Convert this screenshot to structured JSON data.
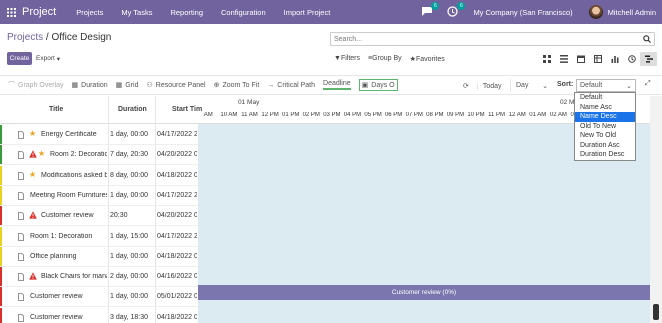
{
  "navbar": {
    "app": "Project",
    "menus": [
      "Projects",
      "My Tasks",
      "Reporting",
      "Configuration",
      "Import Project"
    ],
    "messages_count": "6",
    "activities_count": "6",
    "company": "My Company (San Francisco)",
    "user": "Mitchell Admin",
    "bg_color": "#71639e"
  },
  "breadcrumb": {
    "parent": "Projects",
    "separator": "/",
    "current": "Office Design"
  },
  "search": {
    "placeholder": "Search..."
  },
  "buttons": {
    "create": "Create",
    "export": "Export"
  },
  "filters": {
    "filters": "Filters",
    "group_by": "Group By",
    "favorites": "Favorites"
  },
  "toolbar": {
    "graph_overlay": "Graph Overlay",
    "duration": "Duration",
    "grid": "Grid",
    "resource_panel": "Resource Panel",
    "zoom_to_fit": "Zoom To Fit",
    "critical_path": "Critical Path",
    "deadline": "Deadline",
    "days_o": "Days O",
    "today": "Today",
    "scale": "Day",
    "sort_label": "Sort:",
    "sort_value": "Default"
  },
  "sort_options": [
    "Default",
    "Name Asc",
    "Name Desc",
    "Old To New",
    "New To Old",
    "Duration Asc",
    "Duration Desc"
  ],
  "sort_selected": "Name Desc",
  "columns": {
    "title": "Title",
    "duration": "Duration",
    "start": "Start Tim"
  },
  "timeline": {
    "date1": "01 May",
    "date2": "02 M",
    "hours": [
      "AM",
      "10 AM",
      "11 AM",
      "12 PM",
      "01 PM",
      "02 PM",
      "03 PM",
      "04 PM",
      "05 PM",
      "06 PM",
      "07 PM",
      "08 PM",
      "09 PM",
      "10 PM",
      "11 PM",
      "12 AM",
      "01 AM",
      "02 AM",
      "03 AM",
      "04 AM",
      "05 AM"
    ]
  },
  "rows": [
    {
      "title": "Energy Certificate",
      "duration": "1 day, 00:00",
      "start": "04/17/2022 2",
      "flag": "#3b9a3b",
      "warn": false,
      "star": true
    },
    {
      "title": "Room 2: Decoration",
      "duration": "7 day, 20:30",
      "start": "04/20/2022 0",
      "flag": "#3b9a3b",
      "warn": true,
      "star": true
    },
    {
      "title": "Modifications asked by",
      "duration": "8 day, 00:00",
      "start": "04/18/2022 0",
      "flag": "#e8d21d",
      "warn": false,
      "star": true
    },
    {
      "title": "Meeting Room Furnitures",
      "duration": "1 day, 00:00",
      "start": "04/17/2022 2",
      "flag": "#e8d21d",
      "warn": false,
      "star": false
    },
    {
      "title": "Customer review",
      "duration": "20:30",
      "start": "04/20/2022 0",
      "flag": "#d9302c",
      "warn": true,
      "star": false
    },
    {
      "title": "Room 1: Decoration",
      "duration": "1 day, 15:00",
      "start": "04/17/2022 2",
      "flag": "#e8d21d",
      "warn": false,
      "star": false
    },
    {
      "title": "Office planning",
      "duration": "1 day, 00:00",
      "start": "04/18/2022 0",
      "flag": "#e8d21d",
      "warn": false,
      "star": false
    },
    {
      "title": "Black Chairs for mana",
      "duration": "2 day, 00:00",
      "start": "04/16/2022 0",
      "flag": "#d9302c",
      "warn": true,
      "star": false
    },
    {
      "title": "Customer review",
      "duration": "1 day, 00:00",
      "start": "05/01/2022 0",
      "flag": "#d9302c",
      "warn": false,
      "star": false
    },
    {
      "title": "Customer review",
      "duration": "3 day, 18:30",
      "start": "04/18/2022 0",
      "flag": "#d9302c",
      "warn": false,
      "star": false
    }
  ],
  "bar": {
    "label": "Customer review (0%)"
  }
}
